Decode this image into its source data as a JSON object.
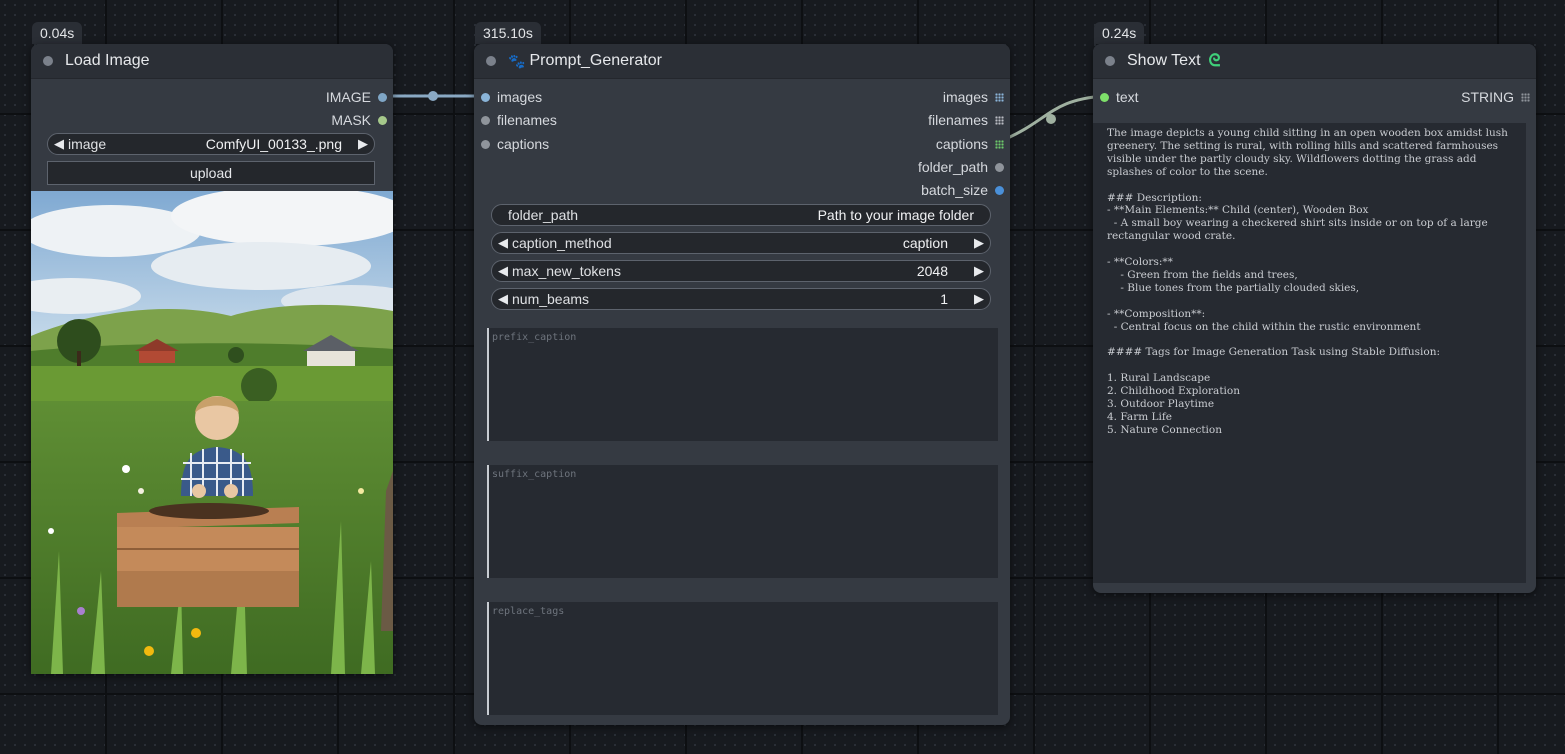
{
  "nodes": {
    "load_image": {
      "timing": "0.04s",
      "title": "Load Image",
      "outputs": [
        {
          "label": "IMAGE",
          "color": "#7fa6c6"
        },
        {
          "label": "MASK",
          "color": "#a6c98b"
        }
      ],
      "image_widget": {
        "label": "image",
        "value": "ComfyUI_00133_.png"
      },
      "upload_label": "upload",
      "preview_icon": "rural-landscape-child-preview"
    },
    "prompt_generator": {
      "timing": "315.10s",
      "title": "Prompt_Generator",
      "title_icon": "paw-icon",
      "inputs": [
        "images",
        "filenames",
        "captions"
      ],
      "outputs": [
        {
          "label": "images",
          "icon": "grid-icon",
          "color": "#8ab4d8"
        },
        {
          "label": "filenames",
          "icon": "grid-icon",
          "color": "#b9bcc2"
        },
        {
          "label": "captions",
          "icon": "grid-icon",
          "color": "#6cc86a"
        },
        {
          "label": "folder_path",
          "icon": "dot",
          "color": "#8f949b"
        },
        {
          "label": "batch_size",
          "icon": "dot",
          "color": "#4a90d9"
        }
      ],
      "widgets": {
        "folder_path": {
          "label": "folder_path",
          "value": "Path to your image folder"
        },
        "caption_method": {
          "label": "caption_method",
          "value": "caption"
        },
        "max_new_tokens": {
          "label": "max_new_tokens",
          "value": "2048"
        },
        "num_beams": {
          "label": "num_beams",
          "value": "1"
        }
      },
      "textareas": {
        "prefix_caption": "prefix_caption",
        "suffix_caption": "suffix_caption",
        "replace_tags": "replace_tags"
      }
    },
    "show_text": {
      "timing": "0.24s",
      "title": "Show Text",
      "title_icon": "snake-icon",
      "input": {
        "label": "text",
        "color": "#7ee06a"
      },
      "output": {
        "label": "STRING"
      },
      "content": "The image depicts a young child sitting in an open wooden box amidst lush greenery. The setting is rural, with rolling hills and scattered farmhouses visible under the partly cloudy sky. Wildflowers dotting the grass add splashes of color to the scene.\n\n### Description:\n- **Main Elements:** Child (center), Wooden Box\n  - A small boy wearing a checkered shirt sits inside or on top of a large rectangular wood crate.\n\n- **Colors:**\n    - Green from the fields and trees,\n    - Blue tones from the partially clouded skies,\n\n- **Composition**:\n  - Central focus on the child within the rustic environment\n\n#### Tags for Image Generation Task using Stable Diffusion:\n\n1. Rural Landscape\n2. Childhood Exploration\n3. Outdoor Playtime\n4. Farm Life\n5. Nature Connection"
    }
  },
  "colors": {
    "image_link": "#8aa9c4",
    "string_link": "#9fb0a0"
  }
}
